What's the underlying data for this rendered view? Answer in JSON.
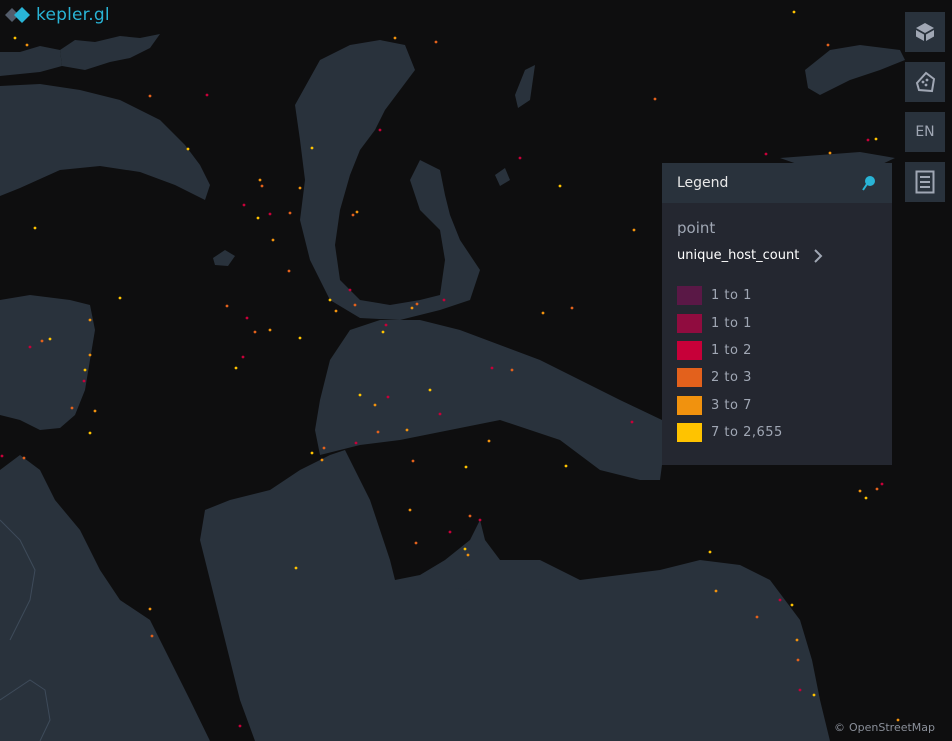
{
  "app": {
    "logo_text": "kepler.gl"
  },
  "controls": {
    "layers_icon": "layers-3d-icon",
    "draw_icon": "draw-polygon-icon",
    "locale_label": "EN",
    "legend_toggle_icon": "legend-list-icon"
  },
  "legend": {
    "header_title": "Legend",
    "pin_icon": "pin-icon",
    "layer_name": "point",
    "field_name": "unique_host_count",
    "expand_icon": "chevron-right-icon",
    "items": [
      {
        "label": "1 to 1",
        "color": "#5a1846"
      },
      {
        "label": "1 to 1",
        "color": "#900c3f"
      },
      {
        "label": "1 to 2",
        "color": "#c70039"
      },
      {
        "label": "2 to 3",
        "color": "#e3611c"
      },
      {
        "label": "3 to 7",
        "color": "#f1920e"
      },
      {
        "label": "7 to 2,655",
        "color": "#ffc300"
      }
    ]
  },
  "attribution": {
    "copyright": "©",
    "text": "OpenStreetMap"
  },
  "colors": {
    "accent": "#29b4d6",
    "land": "#29323c",
    "water": "#0e0e0f"
  }
}
